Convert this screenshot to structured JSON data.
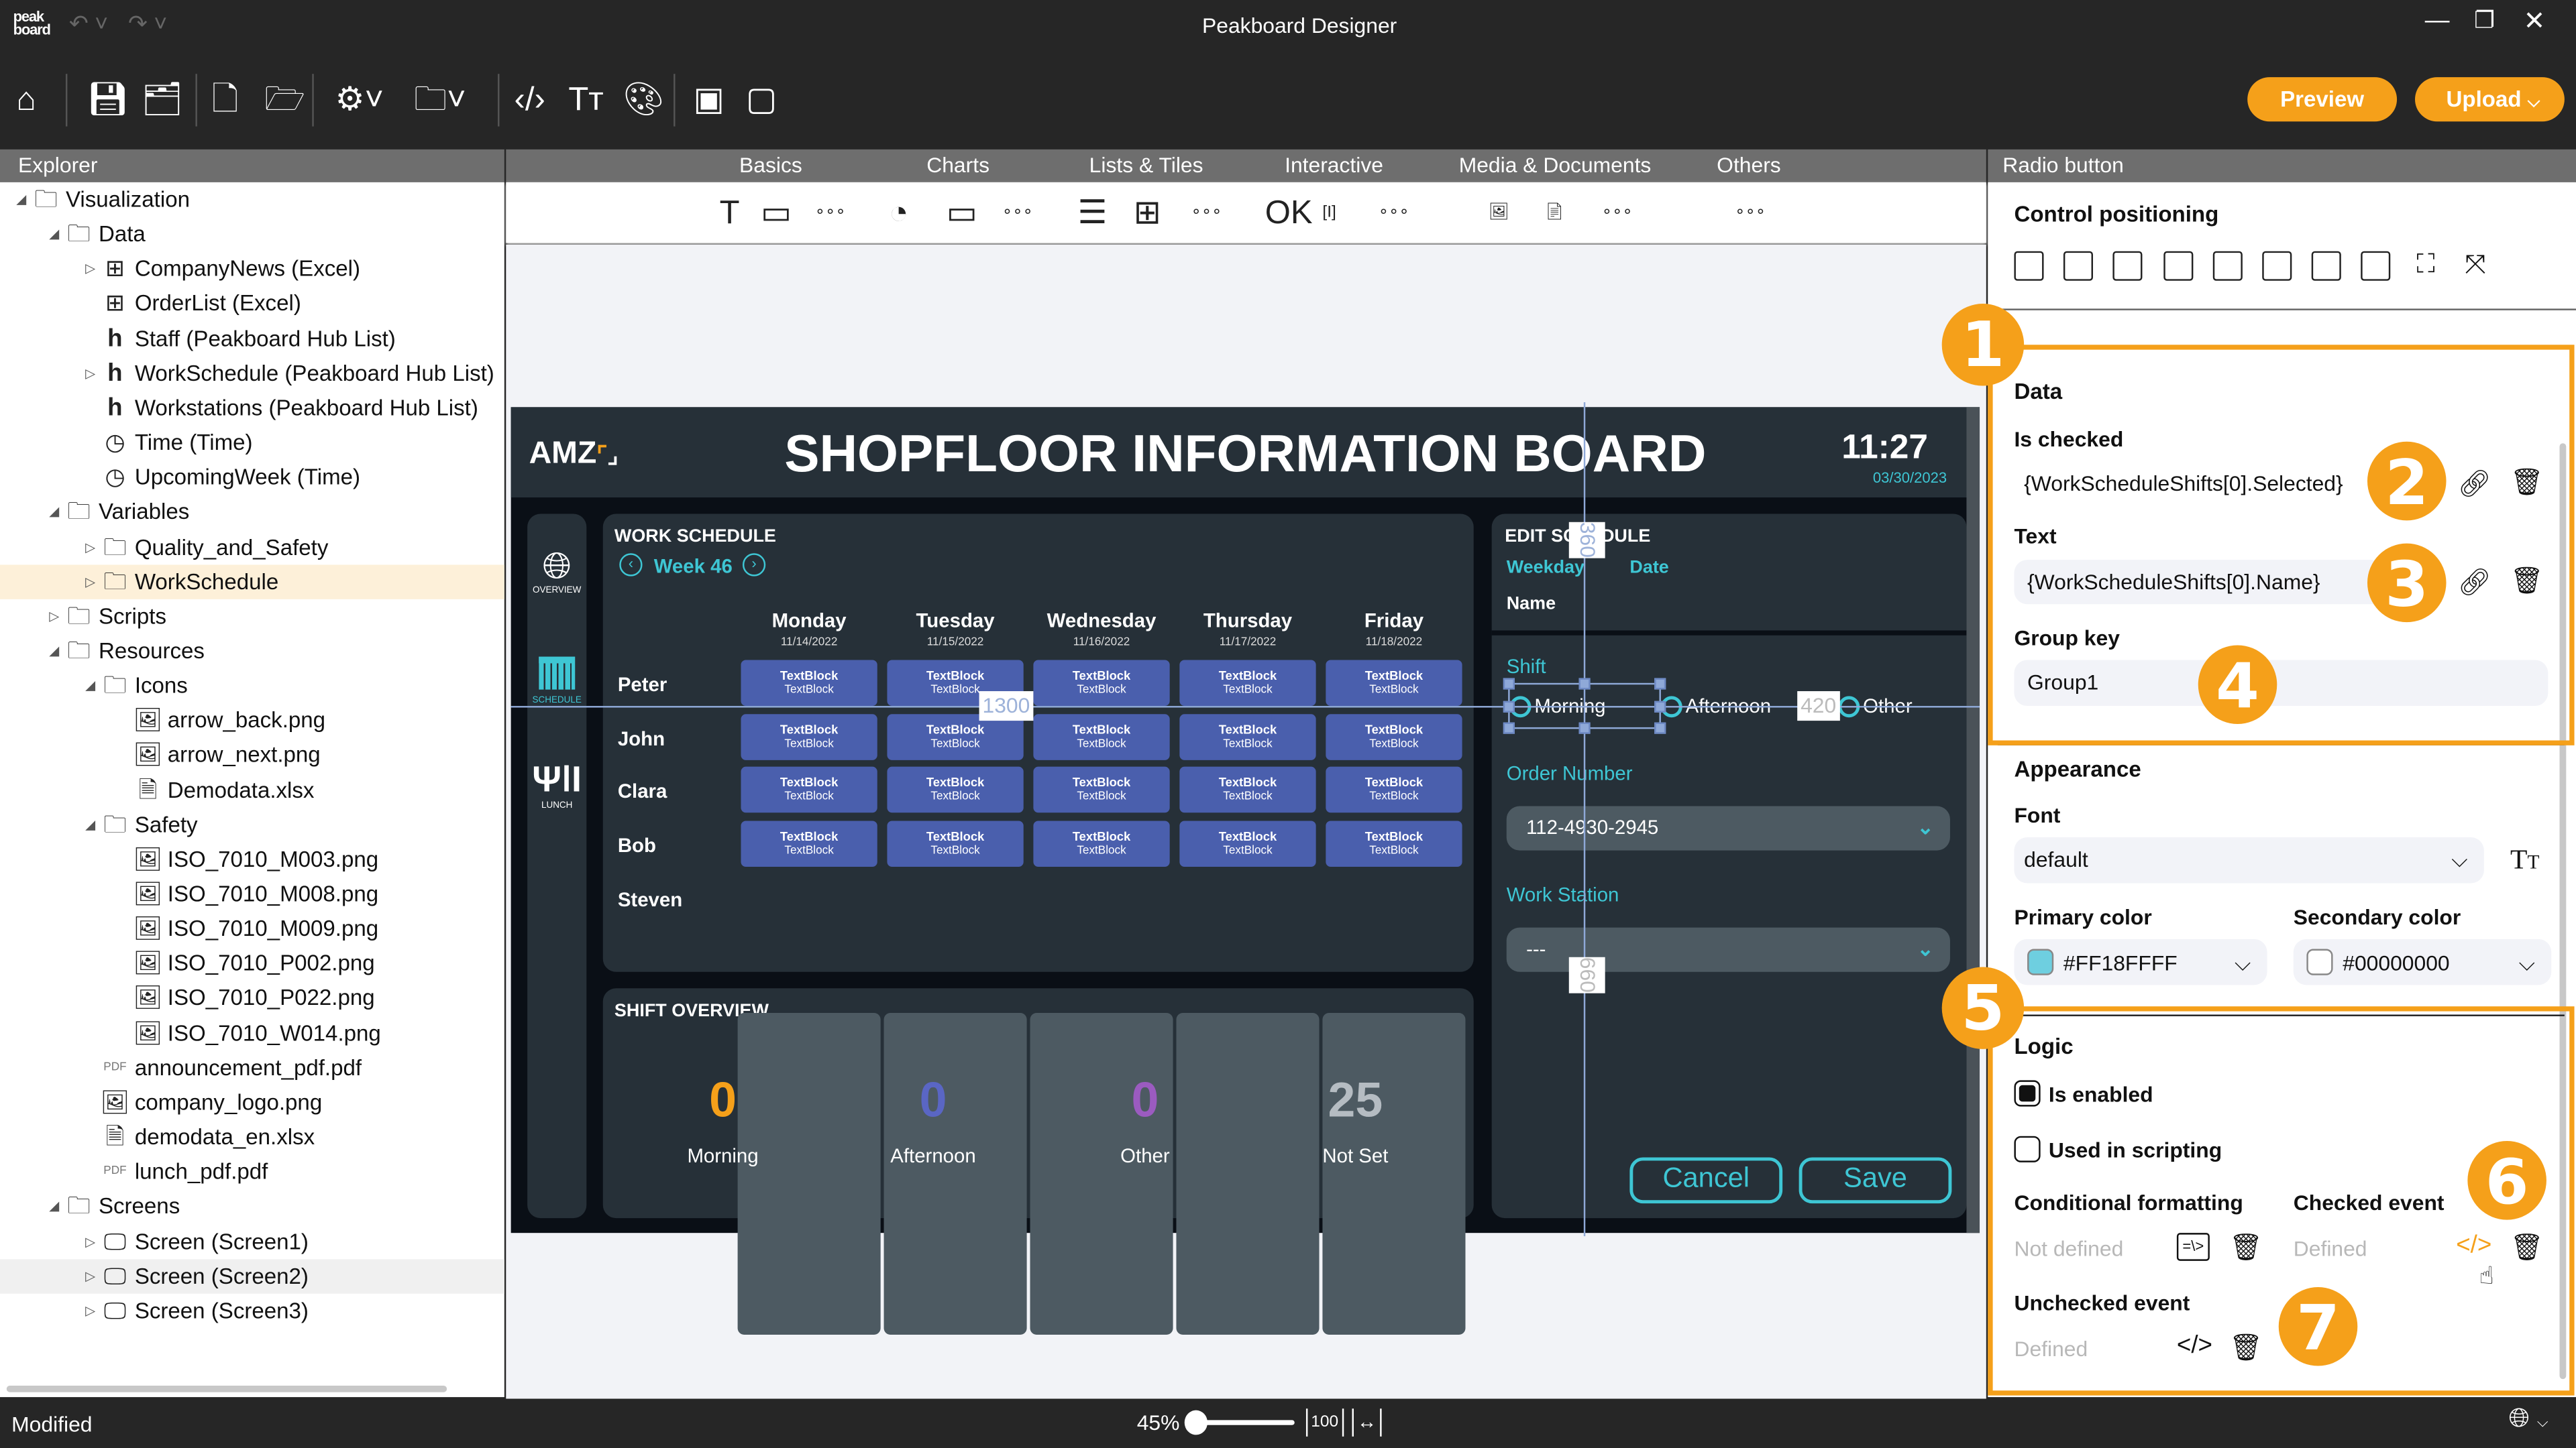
{
  "app": {
    "title": "Peakboard Designer",
    "preview": "Preview",
    "upload": "Upload",
    "accent": "#F5A01A"
  },
  "toolbar": {
    "icons": [
      "home-icon",
      "save-icon",
      "save-as-icon",
      "new-file-icon",
      "open-folder-icon",
      "settings-icon",
      "project-settings-icon",
      "code-icon",
      "font-icon",
      "palette-icon",
      "peakboard-box-icon",
      "edge-icon"
    ]
  },
  "panels": {
    "explorer": "Explorer",
    "properties": "Radio button"
  },
  "toolbox": {
    "tabs": [
      "Basics",
      "Charts",
      "Lists & Tiles",
      "Interactive",
      "Media & Documents",
      "Others"
    ]
  },
  "tree": [
    {
      "label": "Visualization",
      "level": 0,
      "icon": "folder",
      "exp": "open"
    },
    {
      "label": "Data",
      "level": 1,
      "icon": "folder",
      "exp": "open"
    },
    {
      "label": "CompanyNews (Excel)",
      "level": 2,
      "icon": "excel",
      "exp": "closed"
    },
    {
      "label": "OrderList (Excel)",
      "level": 2,
      "icon": "excel",
      "exp": ""
    },
    {
      "label": "Staff (Peakboard Hub List)",
      "level": 2,
      "icon": "hub",
      "exp": ""
    },
    {
      "label": "WorkSchedule (Peakboard Hub List)",
      "level": 2,
      "icon": "hub",
      "exp": "closed"
    },
    {
      "label": "Workstations (Peakboard Hub List)",
      "level": 2,
      "icon": "hub",
      "exp": ""
    },
    {
      "label": "Time (Time)",
      "level": 2,
      "icon": "clock",
      "exp": ""
    },
    {
      "label": "UpcomingWeek (Time)",
      "level": 2,
      "icon": "clock",
      "exp": ""
    },
    {
      "label": "Variables",
      "level": 1,
      "icon": "folder",
      "exp": "open"
    },
    {
      "label": "Quality_and_Safety",
      "level": 2,
      "icon": "folder",
      "exp": "closed"
    },
    {
      "label": "WorkSchedule",
      "level": 2,
      "icon": "folder",
      "exp": "closed",
      "selected": true
    },
    {
      "label": "Scripts",
      "level": 1,
      "icon": "folder",
      "exp": "closed"
    },
    {
      "label": "Resources",
      "level": 1,
      "icon": "folder",
      "exp": "open"
    },
    {
      "label": "Icons",
      "level": 2,
      "icon": "folder",
      "exp": "open"
    },
    {
      "label": "arrow_back.png",
      "level": 3,
      "icon": "image",
      "exp": ""
    },
    {
      "label": "arrow_next.png",
      "level": 3,
      "icon": "image",
      "exp": ""
    },
    {
      "label": "Demodata.xlsx",
      "level": 3,
      "icon": "file",
      "exp": ""
    },
    {
      "label": "Safety",
      "level": 2,
      "icon": "folder",
      "exp": "open"
    },
    {
      "label": "ISO_7010_M003.png",
      "level": 3,
      "icon": "image",
      "exp": ""
    },
    {
      "label": "ISO_7010_M008.png",
      "level": 3,
      "icon": "image",
      "exp": ""
    },
    {
      "label": "ISO_7010_M009.png",
      "level": 3,
      "icon": "image",
      "exp": ""
    },
    {
      "label": "ISO_7010_P002.png",
      "level": 3,
      "icon": "image",
      "exp": ""
    },
    {
      "label": "ISO_7010_P022.png",
      "level": 3,
      "icon": "image",
      "exp": ""
    },
    {
      "label": "ISO_7010_W014.png",
      "level": 3,
      "icon": "image",
      "exp": ""
    },
    {
      "label": "announcement_pdf.pdf",
      "level": 2,
      "icon": "pdf",
      "exp": ""
    },
    {
      "label": "company_logo.png",
      "level": 2,
      "icon": "image",
      "exp": ""
    },
    {
      "label": "demodata_en.xlsx",
      "level": 2,
      "icon": "file",
      "exp": ""
    },
    {
      "label": "lunch_pdf.pdf",
      "level": 2,
      "icon": "pdf",
      "exp": ""
    },
    {
      "label": "Screens",
      "level": 1,
      "icon": "folder",
      "exp": "open"
    },
    {
      "label": "Screen (Screen1)",
      "level": 2,
      "icon": "monitor",
      "exp": "closed"
    },
    {
      "label": "Screen (Screen2)",
      "level": 2,
      "icon": "monitor",
      "exp": "closed",
      "hover": true
    },
    {
      "label": "Screen (Screen3)",
      "level": 2,
      "icon": "monitor",
      "exp": "closed"
    }
  ],
  "board": {
    "logo": "AMZ",
    "title": "SHOPFLOOR INFORMATION BOARD",
    "time": "11:27",
    "date": "03/30/2023",
    "nav": [
      "OVERVIEW",
      "SCHEDULE",
      "LUNCH"
    ],
    "schedule": {
      "title": "WORK SCHEDULE",
      "week": "Week 46",
      "days": [
        {
          "name": "Monday",
          "date": "11/14/2022"
        },
        {
          "name": "Tuesday",
          "date": "11/15/2022"
        },
        {
          "name": "Wednesday",
          "date": "11/16/2022"
        },
        {
          "name": "Thursday",
          "date": "11/17/2022"
        },
        {
          "name": "Friday",
          "date": "11/18/2022"
        }
      ],
      "people": [
        "Peter",
        "John",
        "Clara",
        "Bob",
        "Steven"
      ],
      "cell_title": "TextBlock",
      "cell_sub": "TextBlock"
    },
    "overview": {
      "title": "SHIFT OVERVIEW",
      "items": [
        {
          "value": "0",
          "label": "Morning",
          "color": "#F5A01A"
        },
        {
          "value": "0",
          "label": "Afternoon",
          "color": "#5A66C4"
        },
        {
          "value": "0",
          "label": "Other",
          "color": "#9B5BC0"
        },
        {
          "value": "25",
          "label": "Not Set",
          "color": "#B5BCC2"
        }
      ]
    },
    "edit": {
      "title": "EDIT SCHEDULE",
      "weekday": "Weekday",
      "date": "Date",
      "name": "Name",
      "shift": "Shift",
      "options": [
        "Morning",
        "Afternoon",
        "Other"
      ],
      "order_label": "Order Number",
      "order_value": "112-4930-2945",
      "station_label": "Work Station",
      "station_value": "---",
      "cancel": "Cancel",
      "save": "Save"
    },
    "guides": {
      "left": "1300",
      "top": "360",
      "right": "420",
      "bottom": "660"
    }
  },
  "props": {
    "positioning": "Control positioning",
    "data": {
      "title": "Data",
      "is_checked_label": "Is checked",
      "is_checked": "{WorkScheduleShifts[0].Selected}",
      "text_label": "Text",
      "text": "{WorkScheduleShifts[0].Name}",
      "group_label": "Group key",
      "group": "Group1"
    },
    "appearance": {
      "title": "Appearance",
      "font_label": "Font",
      "font": "default",
      "primary_label": "Primary color",
      "primary": "#FF18FFFF",
      "primary_swatch": "#6ECFE0",
      "secondary_label": "Secondary color",
      "secondary": "#00000000"
    },
    "logic": {
      "title": "Logic",
      "enabled": "Is enabled",
      "enabled_checked": true,
      "scripting": "Used in scripting",
      "scripting_checked": false,
      "cond_label": "Conditional formatting",
      "cond_value": "Not defined",
      "checked_label": "Checked event",
      "checked_value": "Defined",
      "unchecked_label": "Unchecked event",
      "unchecked_value": "Defined"
    }
  },
  "annotations": [
    "1",
    "2",
    "3",
    "4",
    "5",
    "6",
    "7"
  ],
  "status": {
    "text": "Modified",
    "zoom": "45%",
    "zoom_percent": 45,
    "fit100": "100"
  }
}
